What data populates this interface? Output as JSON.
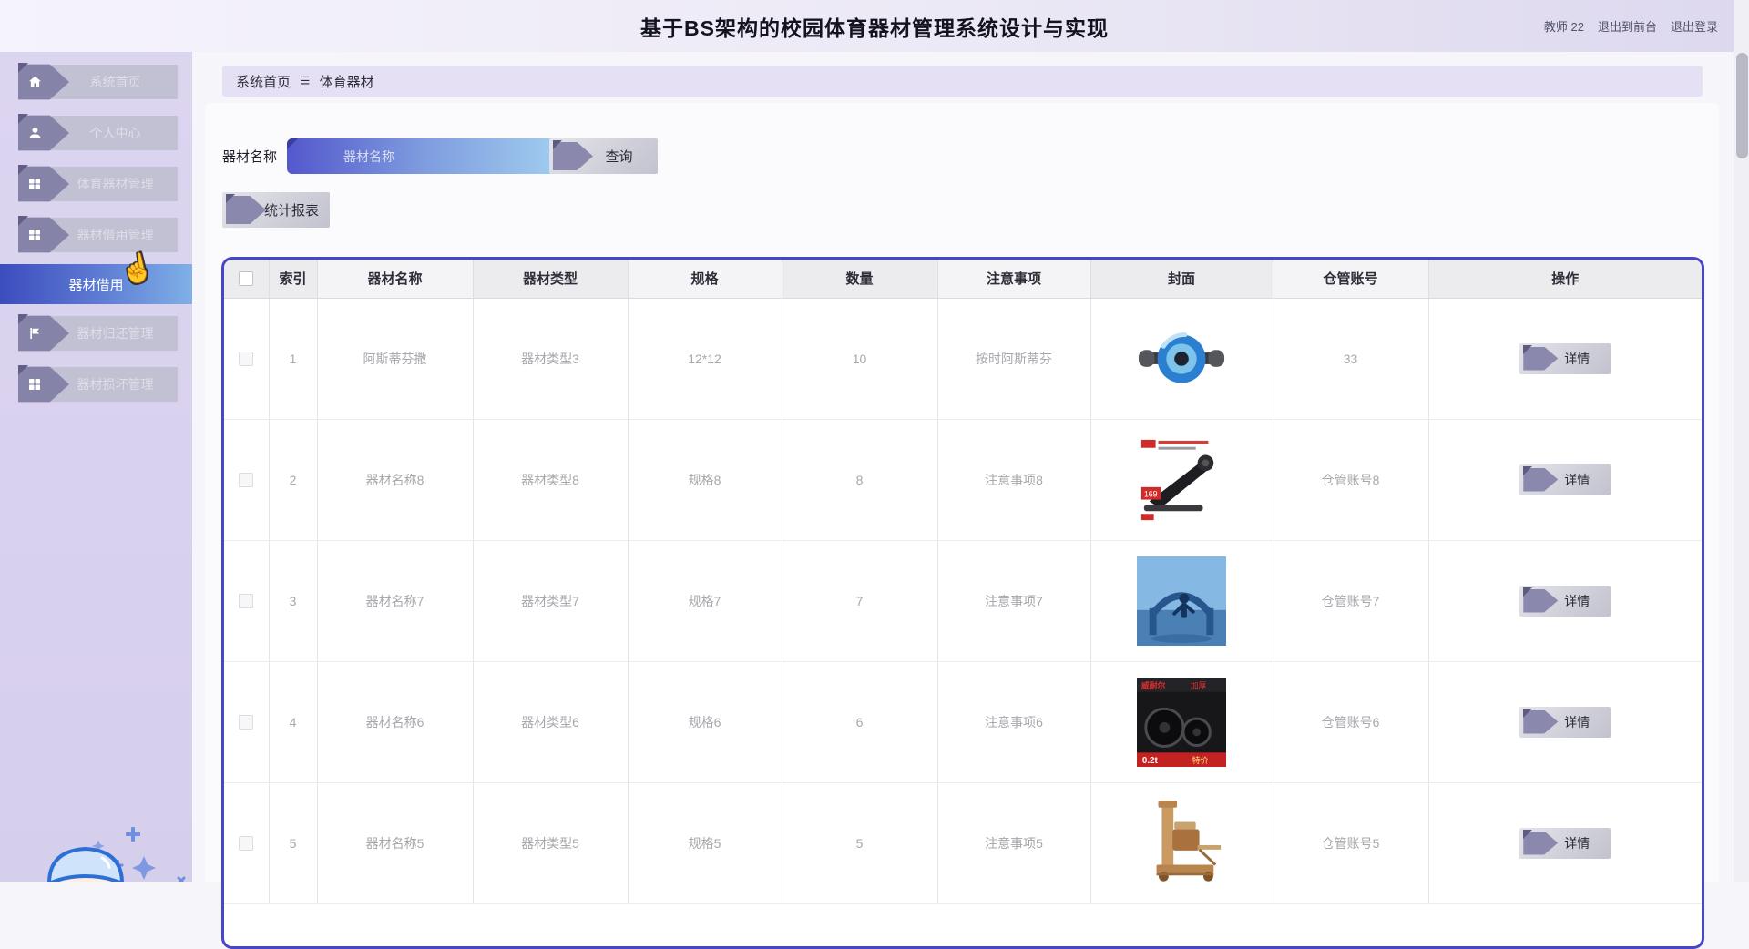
{
  "colors": {
    "accent_border": "#4746cb",
    "active_item_gradient": [
      "#3c4cbe",
      "#7fb0e6"
    ],
    "input_gradient": [
      "#5357cc",
      "#a5d4f2"
    ],
    "pennant": "#8a88ad",
    "sidebar_bg": "#d8d0ec",
    "header_bg": "#ece9f6"
  },
  "header": {
    "title": "基于BS架构的校园体育器材管理系统设计与实现",
    "user_label": "教师 22",
    "exit_front_label": "退出到前台",
    "logout_label": "退出登录"
  },
  "sidebar": {
    "items": [
      {
        "label": "系统首页",
        "icon": "home-icon",
        "active": false
      },
      {
        "label": "个人中心",
        "icon": "user-icon",
        "active": false
      },
      {
        "label": "体育器材管理",
        "icon": "grid-icon",
        "active": false
      },
      {
        "label": "器材借用管理",
        "icon": "grid-icon",
        "active": false
      },
      {
        "label": "器材借用",
        "icon": "",
        "active": true
      },
      {
        "label": "器材归还管理",
        "icon": "flag-icon",
        "active": false
      },
      {
        "label": "器材损坏管理",
        "icon": "grid-icon",
        "active": false
      }
    ]
  },
  "breadcrumb": {
    "home": "系统首页",
    "current": "体育器材"
  },
  "search": {
    "label": "器材名称",
    "placeholder": "器材名称",
    "query_button": "查询",
    "report_button": "统计报表"
  },
  "table": {
    "columns": [
      "索引",
      "器材名称",
      "器材类型",
      "规格",
      "数量",
      "注意事项",
      "封面",
      "仓管账号",
      "操作"
    ],
    "detail_button": "详情",
    "rows": [
      {
        "index": "1",
        "name": "阿斯蒂芬撒",
        "type": "器材类型3",
        "spec": "12*12",
        "qty": "10",
        "note": "按时阿斯蒂芬",
        "cover": "ab-roller-wheel",
        "account": "33"
      },
      {
        "index": "2",
        "name": "器材名称8",
        "type": "器材类型8",
        "spec": "规格8",
        "qty": "8",
        "note": "注意事项8",
        "cover": "abdominal-machine",
        "account": "仓管账号8"
      },
      {
        "index": "3",
        "name": "器材名称7",
        "type": "器材类型7",
        "spec": "规格7",
        "qty": "7",
        "note": "注意事项7",
        "cover": "outdoor-fitness",
        "account": "仓管账号7"
      },
      {
        "index": "4",
        "name": "器材名称6",
        "type": "器材类型6",
        "spec": "规格6",
        "qty": "6",
        "note": "注意事项6",
        "cover": "weight-plates",
        "account": "仓管账号6"
      },
      {
        "index": "5",
        "name": "器材名称5",
        "type": "器材类型5",
        "spec": "规格5",
        "qty": "5",
        "note": "注意事项5",
        "cover": "wooden-reformer",
        "account": "仓管账号5"
      }
    ]
  }
}
